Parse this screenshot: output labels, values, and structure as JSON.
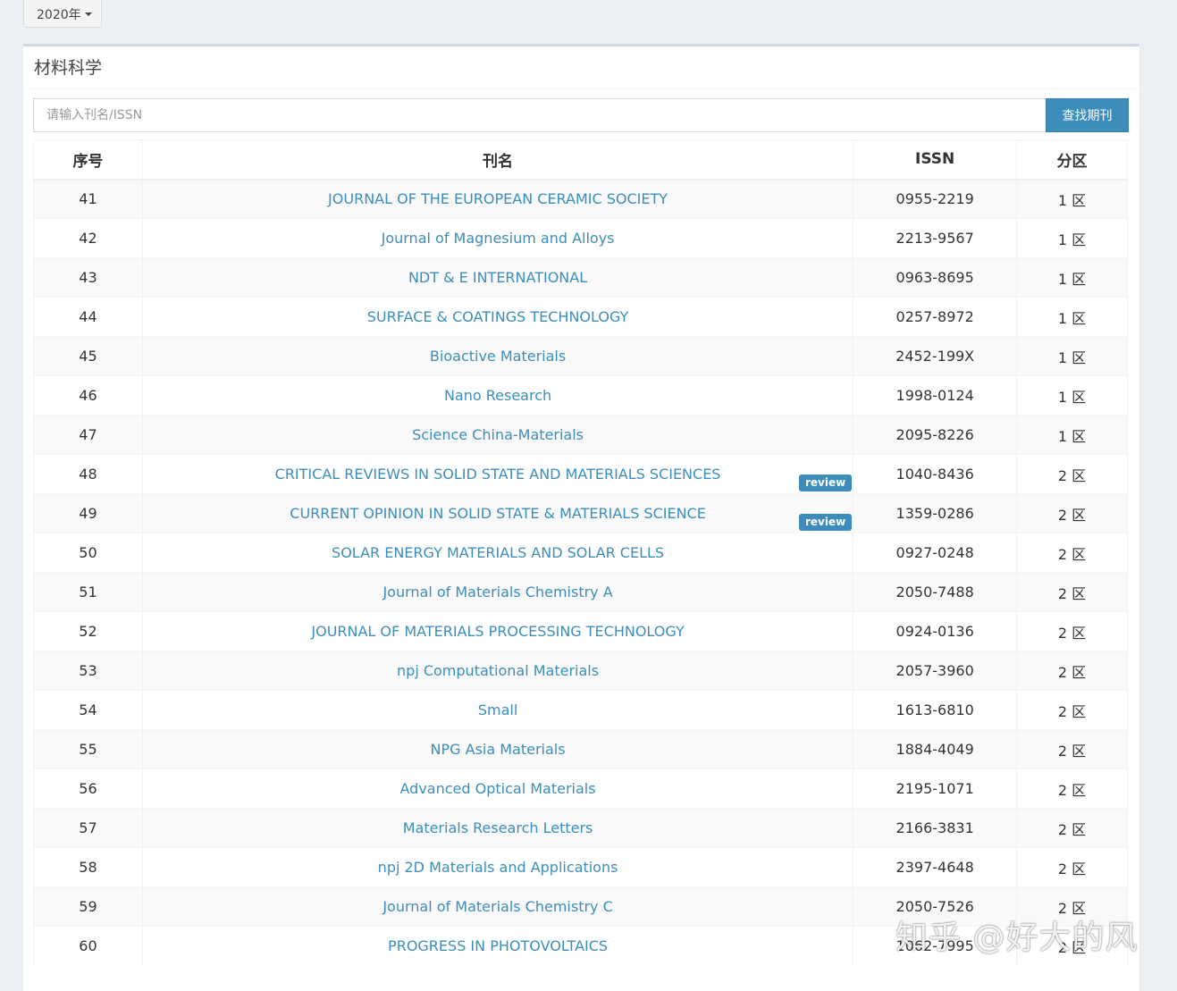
{
  "year_dropdown": {
    "label": "2020年"
  },
  "box": {
    "title": "材料科学"
  },
  "search": {
    "placeholder": "请输入刊名/ISSN",
    "value": "",
    "button_label": "查找期刊"
  },
  "table": {
    "headers": {
      "no": "序号",
      "name": "刊名",
      "issn": "ISSN",
      "zone": "分区"
    },
    "rows": [
      {
        "no": "41",
        "name": "JOURNAL OF THE EUROPEAN CERAMIC SOCIETY",
        "issn": "0955-2219",
        "zone": "1 区",
        "badge": ""
      },
      {
        "no": "42",
        "name": "Journal of Magnesium and Alloys",
        "issn": "2213-9567",
        "zone": "1 区",
        "badge": ""
      },
      {
        "no": "43",
        "name": "NDT & E INTERNATIONAL",
        "issn": "0963-8695",
        "zone": "1 区",
        "badge": ""
      },
      {
        "no": "44",
        "name": "SURFACE & COATINGS TECHNOLOGY",
        "issn": "0257-8972",
        "zone": "1 区",
        "badge": ""
      },
      {
        "no": "45",
        "name": "Bioactive Materials",
        "issn": "2452-199X",
        "zone": "1 区",
        "badge": ""
      },
      {
        "no": "46",
        "name": "Nano Research",
        "issn": "1998-0124",
        "zone": "1 区",
        "badge": ""
      },
      {
        "no": "47",
        "name": "Science China-Materials",
        "issn": "2095-8226",
        "zone": "1 区",
        "badge": ""
      },
      {
        "no": "48",
        "name": "CRITICAL REVIEWS IN SOLID STATE AND MATERIALS SCIENCES",
        "issn": "1040-8436",
        "zone": "2 区",
        "badge": "review"
      },
      {
        "no": "49",
        "name": "CURRENT OPINION IN SOLID STATE & MATERIALS SCIENCE",
        "issn": "1359-0286",
        "zone": "2 区",
        "badge": "review"
      },
      {
        "no": "50",
        "name": "SOLAR ENERGY MATERIALS AND SOLAR CELLS",
        "issn": "0927-0248",
        "zone": "2 区",
        "badge": ""
      },
      {
        "no": "51",
        "name": "Journal of Materials Chemistry A",
        "issn": "2050-7488",
        "zone": "2 区",
        "badge": ""
      },
      {
        "no": "52",
        "name": "JOURNAL OF MATERIALS PROCESSING TECHNOLOGY",
        "issn": "0924-0136",
        "zone": "2 区",
        "badge": ""
      },
      {
        "no": "53",
        "name": "npj Computational Materials",
        "issn": "2057-3960",
        "zone": "2 区",
        "badge": ""
      },
      {
        "no": "54",
        "name": "Small",
        "issn": "1613-6810",
        "zone": "2 区",
        "badge": ""
      },
      {
        "no": "55",
        "name": "NPG Asia Materials",
        "issn": "1884-4049",
        "zone": "2 区",
        "badge": ""
      },
      {
        "no": "56",
        "name": "Advanced Optical Materials",
        "issn": "2195-1071",
        "zone": "2 区",
        "badge": ""
      },
      {
        "no": "57",
        "name": "Materials Research Letters",
        "issn": "2166-3831",
        "zone": "2 区",
        "badge": ""
      },
      {
        "no": "58",
        "name": "npj 2D Materials and Applications",
        "issn": "2397-4648",
        "zone": "2 区",
        "badge": ""
      },
      {
        "no": "59",
        "name": "Journal of Materials Chemistry C",
        "issn": "2050-7526",
        "zone": "2 区",
        "badge": ""
      },
      {
        "no": "60",
        "name": "PROGRESS IN PHOTOVOLTAICS",
        "issn": "1062-7995",
        "zone": "2 区",
        "badge": ""
      }
    ]
  },
  "watermark": {
    "text": "知乎 @好大的风"
  },
  "colors": {
    "accent": "#3c8dbc",
    "background": "#ecf0f5"
  }
}
